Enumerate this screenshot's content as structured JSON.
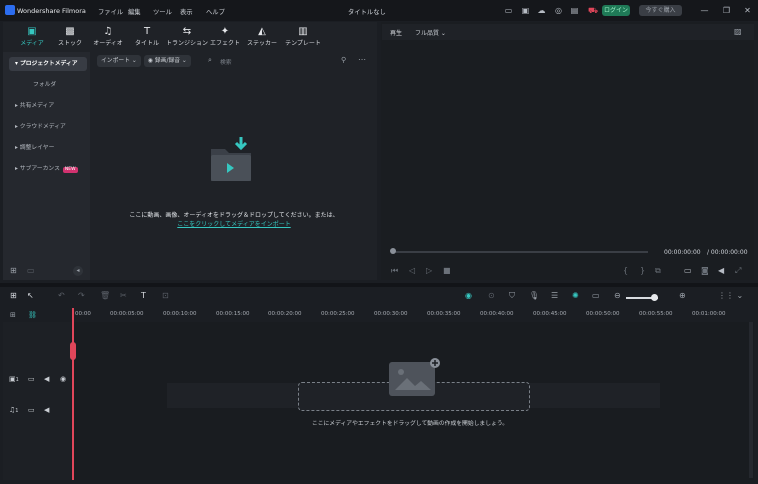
{
  "app": {
    "name": "Wondershare Filmora",
    "document_title": "タイトルなし"
  },
  "menus": [
    "ファイル",
    "編集",
    "ツール",
    "表示",
    "ヘルプ"
  ],
  "top_buttons": {
    "login": "ログイン",
    "buy": "今すぐ購入"
  },
  "tabs": [
    {
      "label": "メディア",
      "icon": "media-icon"
    },
    {
      "label": "ストック",
      "icon": "stock-icon"
    },
    {
      "label": "オーディオ",
      "icon": "audio-icon"
    },
    {
      "label": "タイトル",
      "icon": "title-icon"
    },
    {
      "label": "トランジション",
      "icon": "transition-icon"
    },
    {
      "label": "エフェクト",
      "icon": "effect-icon"
    },
    {
      "label": "ステッカー",
      "icon": "sticker-icon"
    },
    {
      "label": "テンプレート",
      "icon": "template-icon"
    }
  ],
  "sidebar": {
    "items": [
      {
        "label": "プロジェクトメディア"
      },
      {
        "label": "フォルダ"
      },
      {
        "label": "共有メディア"
      },
      {
        "label": "クラウドメディア"
      },
      {
        "label": "調整レイヤー"
      },
      {
        "label": "サブアーカンス",
        "badge": "NEW"
      }
    ]
  },
  "media_bar": {
    "import": "インポート",
    "filter": "録画/録音",
    "search_placeholder": "検索"
  },
  "media_empty": {
    "text": "ここに動画、画像、オーディオをドラッグ＆ドロップしてください。または、",
    "link": "ここをクリックしてメディアをインポート"
  },
  "preview": {
    "tab_play": "再生",
    "quality": "フル品質",
    "current_time": "00:00:00:00",
    "total_time": "/ 00:00:00:00"
  },
  "timeline": {
    "ruler_labels": [
      "00:00",
      "00:00:05:00",
      "00:00:10:00",
      "00:00:15:00",
      "00:00:20:00",
      "00:00:25:00",
      "00:00:30:00",
      "00:00:35:00",
      "00:00:40:00",
      "00:00:45:00",
      "00:00:50:00",
      "00:00:55:00",
      "00:01:00:00"
    ],
    "drop_hint": "ここにメディアやエフェクトをドラッグして動画の作成を開始しましょう。",
    "video_track_no": "1",
    "audio_track_no": "1"
  },
  "colors": {
    "accent": "#36c7c0",
    "login_bg": "#1f7a57",
    "playhead": "#e0465a"
  }
}
